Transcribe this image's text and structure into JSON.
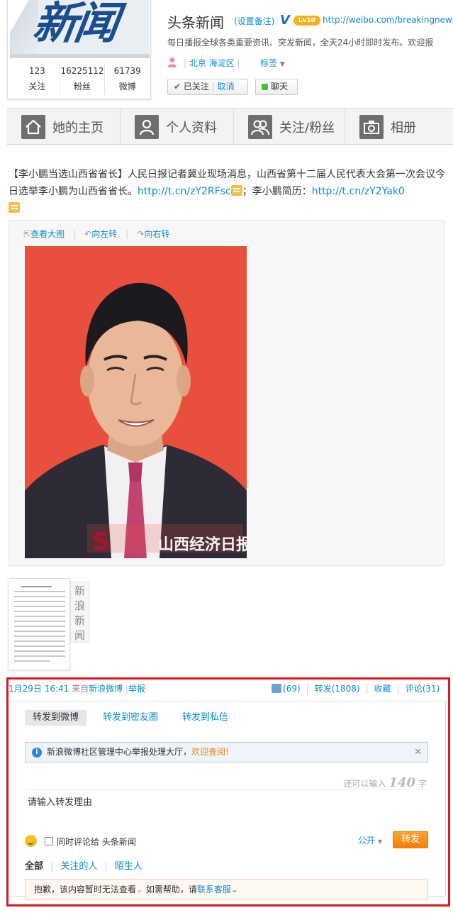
{
  "profile": {
    "name": "头条新闻",
    "remark": "(设置备注)",
    "verified": "V",
    "level": "Lv10",
    "url": "http://weibo.com/breakingnews",
    "description": "每日播报全球各类重要资讯、突发新闻，全天24小时即时发布。欢迎报",
    "location": "北京 海淀区",
    "tags": "标签",
    "stats": [
      {
        "num": "123",
        "label": "关注"
      },
      {
        "num": "16225112",
        "label": "粉丝"
      },
      {
        "num": "61739",
        "label": "微博"
      }
    ],
    "followed": "已关注",
    "cancel": "取消",
    "chat": "聊天",
    "logo_text": "新闻"
  },
  "tabs": [
    "她的主页",
    "个人资料",
    "关注/粉丝",
    "相册"
  ],
  "post": {
    "text_pre": "【李小鹏当选山西省省长】人民日报记者冀业现场消息，山西省第十二届人民代表大会第一次会议今日选举李小鹏为山西省省长。",
    "link1": "http://t.cn/zY2RFsc",
    "text_mid": "；李小鹏简历：",
    "link2": "http://t.cn/zY2Yak0",
    "media_tools": [
      "查看大图",
      "向左转",
      "向右转"
    ],
    "photo_watermark": "山西经济日报",
    "thumb_label": "新浪新闻",
    "time": "1月29日 16:41",
    "from_prefix": "来自",
    "source": "新浪微博",
    "report": "举报",
    "likes": "(69)",
    "forward": "转发(1808)",
    "collect": "收藏",
    "comment": "评论(31)"
  },
  "forward_panel": {
    "tabs": [
      "转发到微博",
      "转发到密友圈",
      "转发到私信"
    ],
    "notice": "新浪微博社区管理中心举报处理大厅，",
    "notice_link": "欢迎查阅!",
    "counter_prefix": "还可以输入",
    "counter_num": "140",
    "counter_suffix": "字",
    "placeholder": "请输入转发理由",
    "also_comment": "同时评论给 头条新闻",
    "visibility": "公开",
    "submit": "转发",
    "filters": [
      "全部",
      "关注的人",
      "陌生人"
    ],
    "sorry": "抱歉，该内容暂时无法查看",
    "sorry_mid": "如需帮助，请",
    "sorry_link": "联系客服"
  },
  "colors": {
    "link": "#0a8cd2",
    "highlight": "#e0141e",
    "submit": "#f57e00",
    "photo_bg": "#e74c3c"
  }
}
